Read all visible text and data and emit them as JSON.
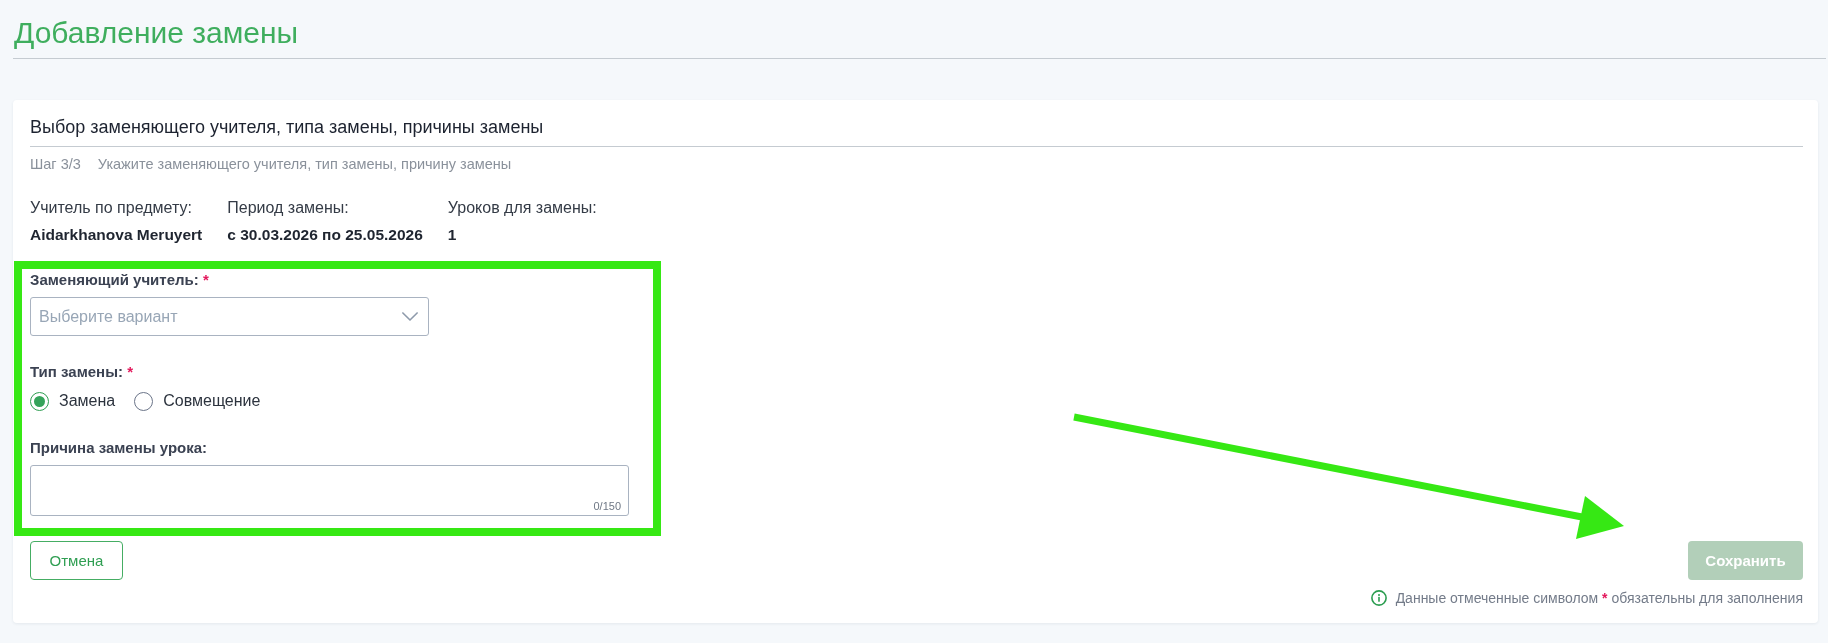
{
  "page": {
    "title": "Добавление замены"
  },
  "card": {
    "title": "Выбор заменяющего учителя, типа замены, причины замены",
    "step": "Шаг 3/3",
    "step_hint": "Укажите заменяющего учителя, тип замены, причину замены",
    "info": [
      {
        "label": "Учитель по предмету:",
        "value": "Aidarkhanova Meruyert"
      },
      {
        "label": "Период замены:",
        "value": "с 30.03.2026 по 25.05.2026"
      },
      {
        "label": "Уроков для замены:",
        "value": "1"
      }
    ]
  },
  "form": {
    "fields": [
      {
        "kind": "select",
        "label": "Заменяющий учитель:",
        "required_mark": "*",
        "placeholder": "Выберите вариант"
      },
      {
        "kind": "radio",
        "label": "Тип замены:",
        "required_mark": "*",
        "options": [
          {
            "label": "Замена",
            "selected": true
          },
          {
            "label": "Совмещение",
            "selected": false
          }
        ]
      },
      {
        "kind": "textarea",
        "label": "Причина замены урока:",
        "counter": "0/150"
      }
    ]
  },
  "buttons": [
    {
      "label": "Отмена",
      "kind": "outline",
      "disabled": false
    },
    {
      "label": "Сохранить",
      "kind": "filled",
      "disabled": true
    }
  ],
  "required_note": {
    "before": "Данные отмеченные символом",
    "mark": "*",
    "after": "обязательны для заполнения"
  }
}
